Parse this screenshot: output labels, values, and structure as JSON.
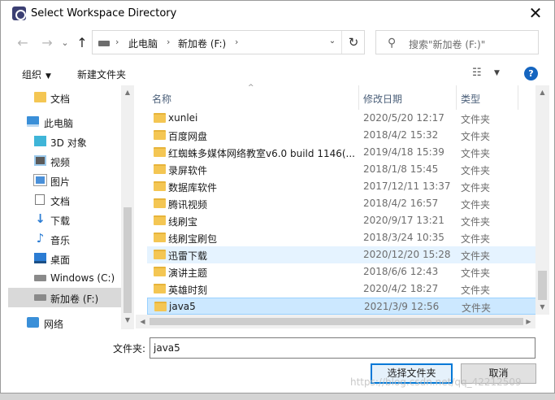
{
  "window": {
    "title": "Select Workspace Directory",
    "close_glyph": "✕"
  },
  "nav": {
    "back_glyph": "←",
    "forward_glyph": "→",
    "recent_glyph": "⌄",
    "up_glyph": "↑",
    "breadcrumb": [
      "此电脑",
      "新加卷 (F:)"
    ],
    "breadcrumb_sep": "›",
    "dropdown_glyph": "⌄",
    "refresh_glyph": "↻",
    "search_placeholder": "搜索\"新加卷 (F:)\"",
    "search_glyph": "⚲"
  },
  "toolbar": {
    "organize": "组织",
    "organize_caret": "▼",
    "new_folder": "新建文件夹",
    "view_glyph": "☷",
    "view_caret": "▼",
    "help_glyph": "?"
  },
  "sidebar": {
    "items": [
      {
        "label": "文档"
      },
      {
        "label": "此电脑"
      },
      {
        "label": "3D 对象"
      },
      {
        "label": "视频"
      },
      {
        "label": "图片"
      },
      {
        "label": "文档"
      },
      {
        "label": "下载"
      },
      {
        "label": "音乐"
      },
      {
        "label": "桌面"
      },
      {
        "label": "Windows (C:)"
      },
      {
        "label": "新加卷 (F:)"
      },
      {
        "label": "网络"
      }
    ],
    "down_glyph": "↓",
    "music_glyph": "♪"
  },
  "columns": {
    "name": "名称",
    "modified": "修改日期",
    "type": "类型",
    "sort_glyph": "^"
  },
  "files": [
    {
      "name": "xunlei",
      "modified": "2020/5/20 12:17",
      "type": "文件夹"
    },
    {
      "name": "百度网盘",
      "modified": "2018/4/2 15:32",
      "type": "文件夹"
    },
    {
      "name": "红蜘蛛多媒体网络教室v6.0 build 1146(...",
      "modified": "2019/4/18 15:39",
      "type": "文件夹"
    },
    {
      "name": "录屏软件",
      "modified": "2018/1/8 15:45",
      "type": "文件夹"
    },
    {
      "name": "数据库软件",
      "modified": "2017/12/11 13:37",
      "type": "文件夹"
    },
    {
      "name": "腾讯视频",
      "modified": "2018/4/2 16:57",
      "type": "文件夹"
    },
    {
      "name": "线刷宝",
      "modified": "2020/9/17 13:21",
      "type": "文件夹"
    },
    {
      "name": "线刷宝刷包",
      "modified": "2018/3/24 10:35",
      "type": "文件夹"
    },
    {
      "name": "迅雷下载",
      "modified": "2020/12/20 15:28",
      "type": "文件夹"
    },
    {
      "name": "演讲主题",
      "modified": "2018/6/6 12:43",
      "type": "文件夹"
    },
    {
      "name": "英雄时刻",
      "modified": "2020/4/2 18:27",
      "type": "文件夹"
    },
    {
      "name": "java5",
      "modified": "2021/3/9 12:56",
      "type": "文件夹"
    }
  ],
  "scroll": {
    "up_glyph": "▲",
    "down_glyph": "▼",
    "left_glyph": "◀",
    "right_glyph": "▶"
  },
  "footer": {
    "folder_label": "文件夹:",
    "folder_value": "java5",
    "select_button": "选择文件夹",
    "cancel_button": "取消"
  },
  "watermark": "https://blog.csdn.net/qq_42212509",
  "colors": {
    "selected_row": "#cce8ff",
    "hover_row": "#e5f3ff",
    "accent": "#0078d7",
    "folder": "#f4c653"
  }
}
